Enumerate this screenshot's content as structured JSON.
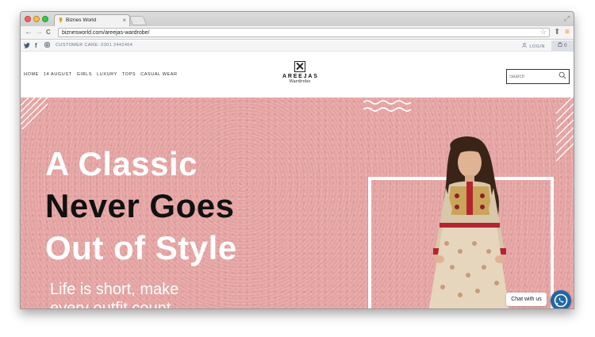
{
  "browser": {
    "tab_title": "Biznes World",
    "tab_close": "×",
    "url": "biznesworld.com/areejas-wardrobe/",
    "nav": {
      "back": "←",
      "forward": "→",
      "reload": "C"
    },
    "icons": [
      "star-icon",
      "extension-icon",
      "menu-icon"
    ]
  },
  "topbar": {
    "social": [
      "twitter-icon",
      "facebook-icon",
      "instagram-icon"
    ],
    "customer_care": "CUSTOMER CARE: 0301 2442464",
    "login": "LOGIN",
    "cart_count": "0"
  },
  "header": {
    "menu": [
      "HOME",
      "14 AUGUST",
      "GIRLS",
      "LUXURY",
      "TOPS",
      "CASUAL WEAR"
    ],
    "logo_name": "AREEJAS",
    "logo_sub": "Wardrobe",
    "search_placeholder": "Search"
  },
  "hero": {
    "line1": "A Classic",
    "line2": "Never Goes",
    "line3": "Out of Style",
    "sub1": "Life is short, make",
    "sub2": "every outfit count"
  },
  "chat": {
    "label": "Chat with us"
  },
  "colors": {
    "hero_bg": "#e7a7a5",
    "whatsapp": "#1f66a7",
    "accent_orange": "#f28a1a"
  }
}
